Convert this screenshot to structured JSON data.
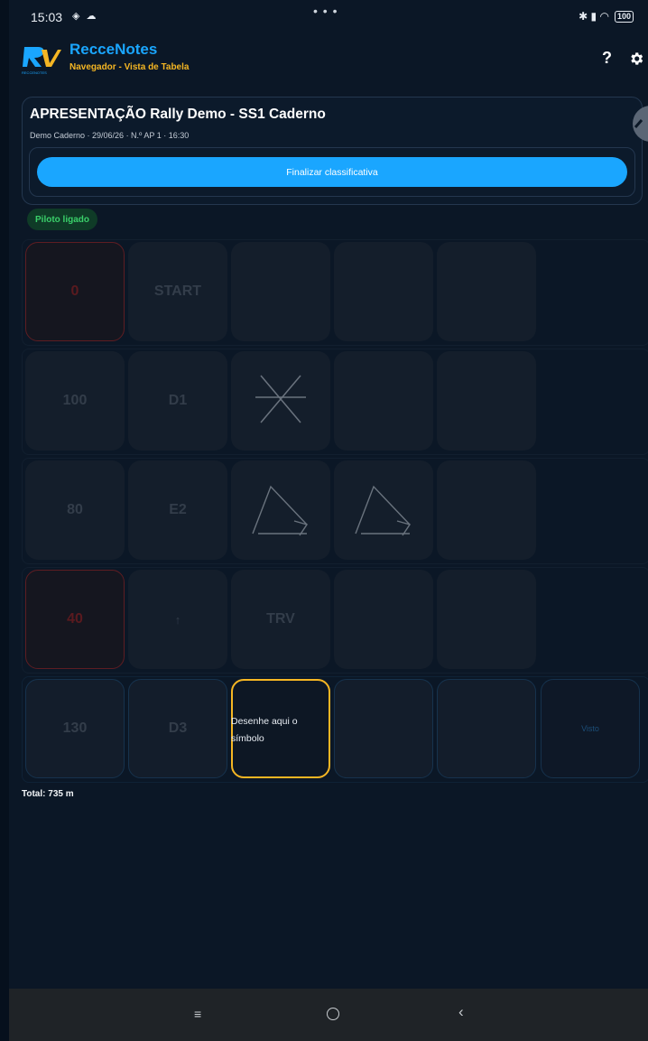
{
  "status_bar": {
    "time": "15:03",
    "left_icons": "◈ ☁",
    "center_dots": "• • •",
    "right_icons": "✱ ▮ ◠",
    "battery": "100"
  },
  "header": {
    "title": "RecceNotes",
    "subtitle": "Navegador - Vista de Tabela",
    "help_label": "?",
    "logo_text": "RECCENOTES"
  },
  "stage": {
    "title": "APRESENTAÇÃO Rally Demo - SS1 Caderno",
    "meta": "Demo Caderno · 29/06/26 · N.º AP 1 · 16:30",
    "finish_button_label": "Finalizar classificativa"
  },
  "pilot_status": "Piloto ligado",
  "grid": {
    "rows": [
      {
        "distance": "0",
        "note": "START"
      },
      {
        "distance": "100",
        "note": "D1"
      },
      {
        "distance": "80",
        "note": "E2"
      },
      {
        "distance": "40",
        "note": "↑",
        "symbol_text": "TRV"
      },
      {
        "distance": "130",
        "note": "D3",
        "draw_hint": "Desenhe aqui o símbolo",
        "visto": "Visto"
      }
    ]
  },
  "total": "Total: 735 m",
  "colors": {
    "accent": "#1aa6ff",
    "subtitle": "#f5b623",
    "editing_border": "#f5b623",
    "pilot_badge_text": "#3ad06a",
    "danger_border": "#5e1d22"
  },
  "nav_bar": {
    "menu_glyph": "≡",
    "back_glyph": "‹"
  }
}
